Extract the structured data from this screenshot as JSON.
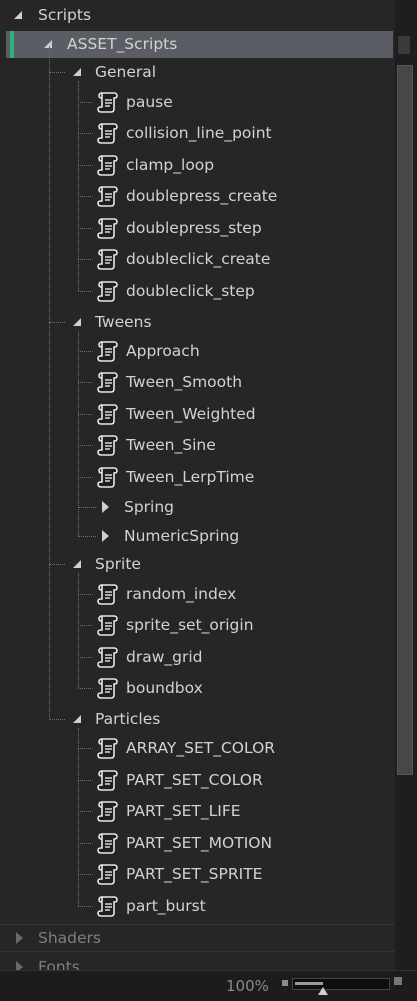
{
  "tree": {
    "root": "Scripts",
    "selected_folder": "ASSET_Scripts",
    "groups": [
      {
        "name": "General",
        "items": [
          "pause",
          "collision_line_point",
          "clamp_loop",
          "doublepress_create",
          "doublepress_step",
          "doubleclick_create",
          "doubleclick_step"
        ]
      },
      {
        "name": "Tweens",
        "items": [
          "Approach",
          "Tween_Smooth",
          "Tween_Weighted",
          "Tween_Sine",
          "Tween_LerpTime"
        ],
        "subfolders": [
          "Spring",
          "NumericSpring"
        ]
      },
      {
        "name": "Sprite",
        "items": [
          "random_index",
          "sprite_set_origin",
          "draw_grid",
          "boundbox"
        ]
      },
      {
        "name": "Particles",
        "items": [
          "ARRAY_SET_COLOR",
          "PART_SET_COLOR",
          "PART_SET_LIFE",
          "PART_SET_MOTION",
          "PART_SET_SPRITE",
          "part_burst"
        ]
      }
    ],
    "collapsed_roots": [
      "Shaders",
      "Fonts"
    ]
  },
  "statusbar": {
    "zoom": "100%",
    "zoom_level": 0.3
  },
  "colors": {
    "selection": "#5a5d63",
    "accent": "#2fb07a",
    "background": "#262626"
  },
  "icons": {
    "script": "script-scroll-icon",
    "expanded": "triangle-expanded-icon",
    "collapsed": "triangle-collapsed-icon"
  }
}
